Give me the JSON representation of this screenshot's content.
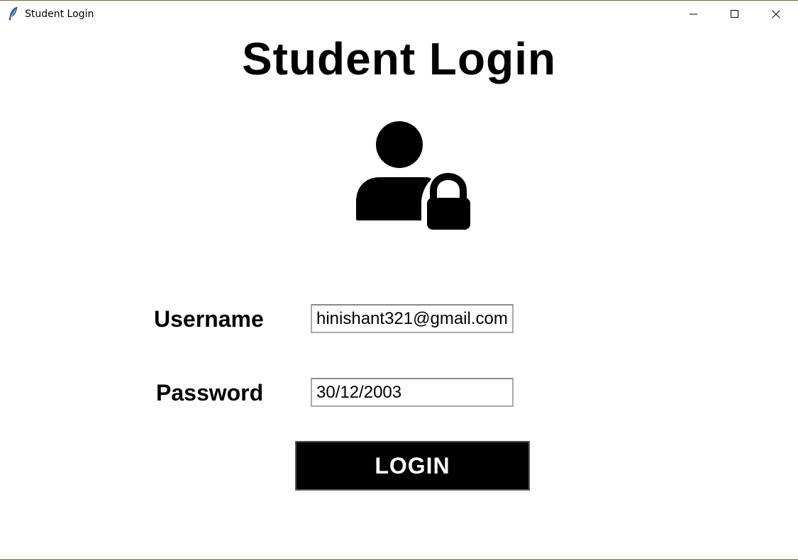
{
  "window": {
    "title": "Student Login",
    "app_icon": "feather-icon",
    "controls": [
      "minimize-icon",
      "maximize-icon",
      "close-icon"
    ]
  },
  "main": {
    "heading": "Student Login",
    "icon": "user-lock-icon"
  },
  "form": {
    "username_label": "Username",
    "username_value": "hinishant321@gmail.com",
    "password_label": "Password",
    "password_value": "30/12/2003",
    "login_label": "LOGIN"
  },
  "colors": {
    "background": "#ffffff",
    "button_background": "#000000",
    "button_text": "#ffffff",
    "field_border": "#a9a9a9"
  }
}
